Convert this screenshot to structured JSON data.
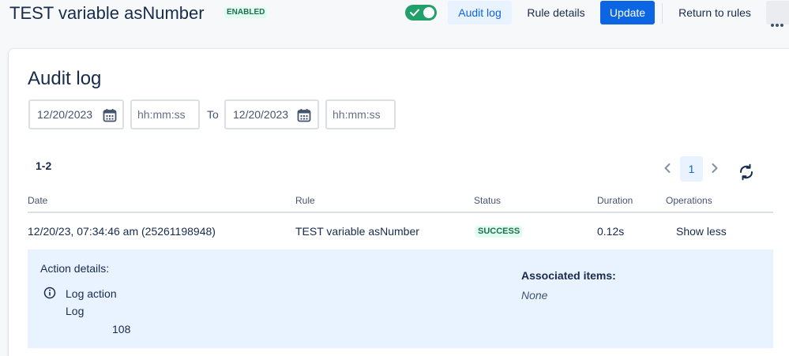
{
  "header": {
    "title": "TEST variable asNumber",
    "status_lozenge": "ENABLED",
    "toggle_state": "on",
    "audit_log_button": "Audit log",
    "rule_details_button": "Rule details",
    "update_button": "Update",
    "return_button": "Return to rules",
    "more_icon": "more-horizontal-icon"
  },
  "colors": {
    "primary": "#0c66e4",
    "success": "#22a06b",
    "selected_bg": "#e9f2ff",
    "success_lozenge_bg": "#dffcf0",
    "success_lozenge_text": "#216e4e"
  },
  "audit": {
    "title": "Audit log",
    "filters": {
      "from_date": "12/20/2023",
      "from_time_placeholder": "hh:mm:ss",
      "to_label": "To",
      "to_date": "12/20/2023",
      "to_time_placeholder": "hh:mm:ss"
    },
    "count": "1-2",
    "pagination": {
      "current_page": "1"
    },
    "table": {
      "headers": [
        "Date",
        "Rule",
        "Status",
        "Duration",
        "Operations"
      ],
      "rows": [
        {
          "date": "12/20/23, 07:34:46 am (25261198948)",
          "rule": "TEST variable asNumber",
          "status": "SUCCESS",
          "duration": "0.12s",
          "operation": "Show less"
        }
      ]
    },
    "details": {
      "action_title": "Action details:",
      "action_name": "Log action",
      "action_label": "Log",
      "action_value": "108",
      "associated_title": "Associated items:",
      "associated_value": "None"
    }
  }
}
